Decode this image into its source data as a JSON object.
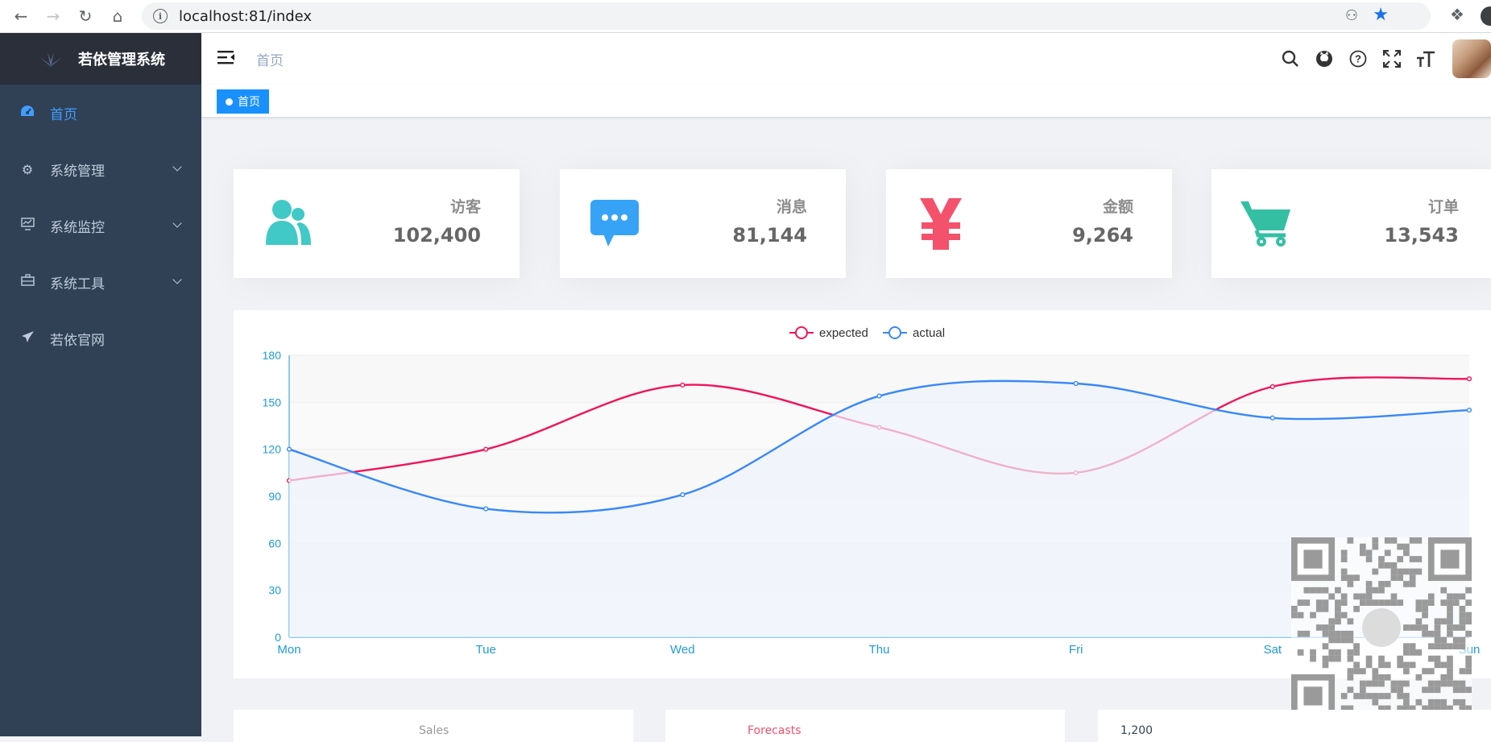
{
  "browser": {
    "url": "localhost:81/index"
  },
  "sidebar": {
    "title": "若依管理系统",
    "items": [
      {
        "label": "首页",
        "icon": "dashboard-icon"
      },
      {
        "label": "系统管理",
        "icon": "gear-icon"
      },
      {
        "label": "系统监控",
        "icon": "monitor-icon"
      },
      {
        "label": "系统工具",
        "icon": "toolbox-icon"
      },
      {
        "label": "若依官网",
        "icon": "send-icon"
      }
    ]
  },
  "header": {
    "breadcrumb": "首页",
    "tools": [
      "search-icon",
      "github-icon",
      "question-icon",
      "fullscreen-icon",
      "font-size-icon"
    ]
  },
  "tags": {
    "active": "首页"
  },
  "cards": [
    {
      "label": "访客",
      "value": "102,400",
      "icon": "people-icon",
      "color": "#40c9c6"
    },
    {
      "label": "消息",
      "value": "81,144",
      "icon": "message-icon",
      "color": "#36a3f7"
    },
    {
      "label": "金额",
      "value": "9,264",
      "icon": "money-icon",
      "color": "#f4516c"
    },
    {
      "label": "订单",
      "value": "13,543",
      "icon": "shopping-icon",
      "color": "#34bfa3"
    }
  ],
  "chart_data": {
    "type": "line",
    "categories": [
      "Mon",
      "Tue",
      "Wed",
      "Thu",
      "Fri",
      "Sat",
      "Sun"
    ],
    "series": [
      {
        "name": "expected",
        "values": [
          100,
          120,
          161,
          134,
          105,
          160,
          165
        ],
        "color": "#f0145a"
      },
      {
        "name": "actual",
        "values": [
          120,
          82,
          91,
          154,
          162,
          140,
          145
        ],
        "color": "#3888fa"
      }
    ],
    "yticks": [
      0,
      30,
      60,
      90,
      120,
      150,
      180
    ],
    "ylim": [
      0,
      180
    ],
    "legend": "top-center",
    "grid": true
  },
  "bottom": {
    "sales": "Sales",
    "forecasts": "Forecasts",
    "third": "1,200"
  }
}
